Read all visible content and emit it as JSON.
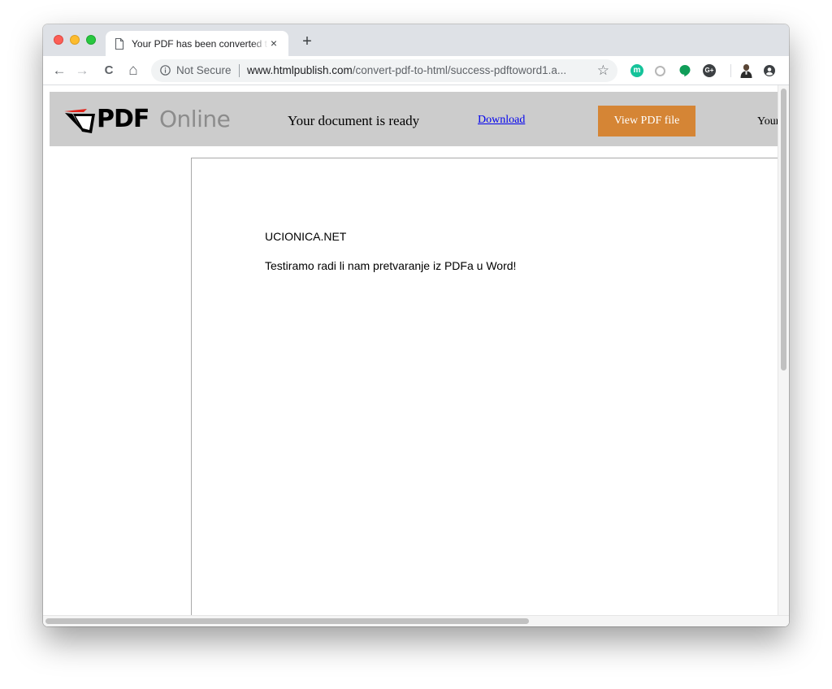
{
  "browser": {
    "tab_title": "Your PDF has been converted to HTML",
    "tab_close": "×",
    "new_tab": "+",
    "security_label": "Not Secure",
    "url_host": "www.htmlpublish.com",
    "url_path": "/convert-pdf-to-html/success-pdftoword1.a...",
    "nav_back": "←",
    "nav_forward": "→",
    "nav_reload": "C",
    "nav_home": "⌂",
    "bookmark": "☆"
  },
  "extensions": {
    "icons": [
      "grammarly-icon",
      "circle-extension-icon",
      "hangouts-icon",
      "gplus-icon",
      "profile-avatar",
      "account-icon"
    ],
    "colors": [
      "#15c39a",
      "#b7b7b7",
      "#0f9d58",
      "#3c4043"
    ],
    "grammarly_letter": "m"
  },
  "site_header": {
    "logo_bold": "PDF",
    "logo_light": "Online",
    "status_text": "Your document is ready",
    "download_label": "Download",
    "view_button_label": "View PDF file",
    "truncated_text": "Your",
    "background": "#cccccc",
    "button_color": "#d58535",
    "link_color": "#0000ee"
  },
  "document": {
    "line1": "UCIONICA.NET",
    "line2": "Testiramo radi li nam pretvaranje iz PDFa u Word!"
  }
}
